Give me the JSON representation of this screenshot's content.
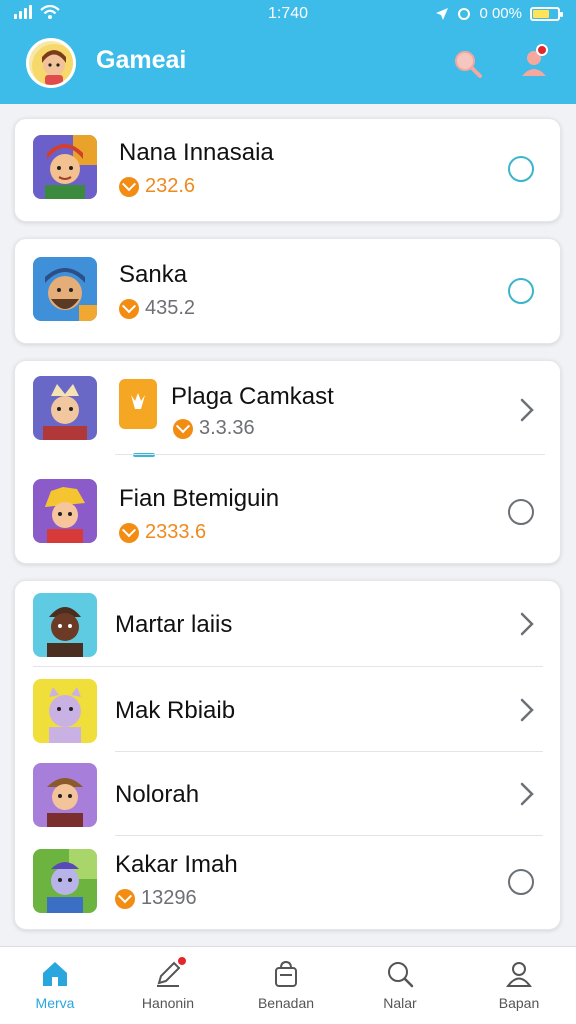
{
  "status_bar": {
    "time": "1:740",
    "battery": "0 00%"
  },
  "header": {
    "title": "Gameai"
  },
  "players": [
    {
      "name": "Nana Innasaia",
      "score": "232.6",
      "score_color": "orange",
      "control": "radio-teal"
    },
    {
      "name": "Sanka",
      "score": "435.2",
      "score_color": "gray",
      "control": "radio-teal"
    },
    {
      "name": "Plaga Camkast",
      "score": "3.3.36",
      "score_color": "gray",
      "control": "chevron"
    },
    {
      "name": "Fian Btemiguin",
      "score": "2333.6",
      "score_color": "orange",
      "control": "radio-grey"
    },
    {
      "name": "Martar laiis",
      "control": "chevron"
    },
    {
      "name": "Mak Rbiaib",
      "control": "chevron"
    },
    {
      "name": "Nolorah",
      "control": "chevron"
    },
    {
      "name": "Kakar Imah",
      "score": "13296",
      "score_color": "gray",
      "control": "radio-grey"
    }
  ],
  "tabs": [
    {
      "label": "Merva",
      "icon": "home-icon",
      "active": true
    },
    {
      "label": "Hanonin",
      "icon": "edit-icon",
      "active": false
    },
    {
      "label": "Benadan",
      "icon": "bag-icon",
      "active": false
    },
    {
      "label": "Nalar",
      "icon": "search-icon",
      "active": false
    },
    {
      "label": "Bapan",
      "icon": "profile-icon",
      "active": false
    }
  ],
  "colors": {
    "header": "#3dbbe9",
    "accent": "#2aa6df",
    "coin": "#f28c13",
    "radio": "#3bb6c8",
    "badge": "#e2262b"
  }
}
